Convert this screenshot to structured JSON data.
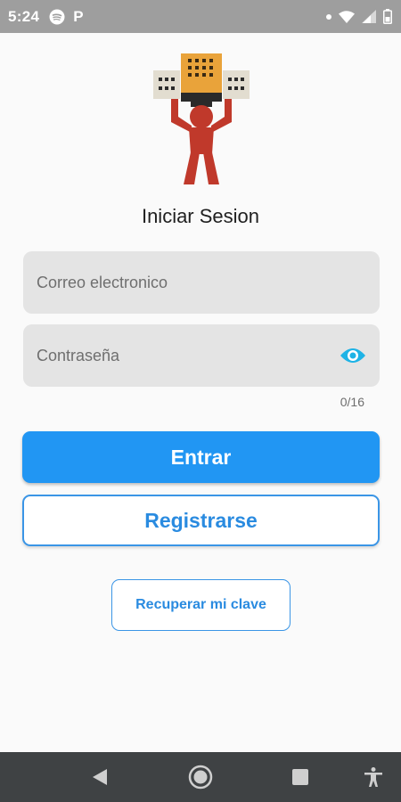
{
  "status_bar": {
    "time": "5:24",
    "p_label": "P",
    "left_icons": [
      "spotify-icon"
    ],
    "right_icons": [
      "notification-dot-icon",
      "wifi-icon",
      "signal-icon",
      "battery-icon"
    ]
  },
  "logo": {
    "icon": "building-lifting-person-logo"
  },
  "page": {
    "title": "Iniciar Sesion"
  },
  "form": {
    "email_placeholder": "Correo electronico",
    "email_value": "",
    "password_placeholder": "Contraseña",
    "password_value": "",
    "password_counter": "0/16",
    "visibility_icon": "eye-icon"
  },
  "buttons": {
    "login": "Entrar",
    "register": "Registrarse",
    "recover": "Recuperar mi clave"
  },
  "nav_bar": {
    "icons": [
      "back-icon",
      "home-icon",
      "recents-icon",
      "accessibility-icon"
    ]
  },
  "colors": {
    "primary": "#2196f3",
    "accent_text": "#2a8be0",
    "status_bar": "#9e9e9e",
    "nav_bar": "#3f4244",
    "field_bg": "#e4e4e4",
    "eye_icon": "#1eb3e6"
  }
}
